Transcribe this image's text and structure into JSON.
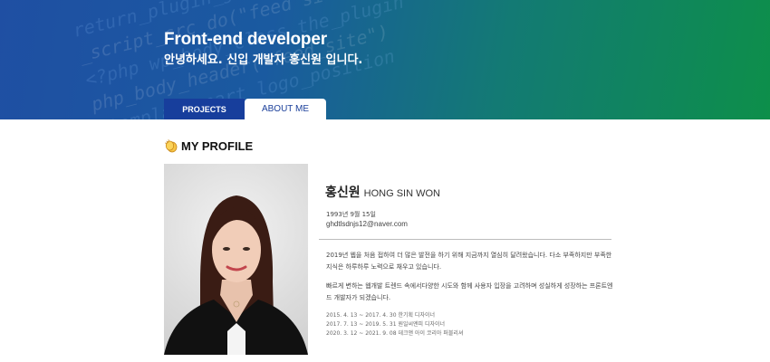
{
  "hero": {
    "title": "Front-end developer",
    "subtitle": "안녕하세요. 신입 개발자 홍신원 입니다.",
    "code_lines": [
      "return_plugin_get_Tags_ti",
      "_script_src_do(\"feed site\")",
      "<?php wp_body_class_the_plugin",
      "php_body_header(\"feed_site\")",
      "_template_part_logo_position"
    ]
  },
  "tabs": [
    {
      "label": "PROJECTS",
      "active": false
    },
    {
      "label": "ABOUT ME",
      "active": true
    }
  ],
  "profile": {
    "section_icon": "clapping-hands-icon",
    "section_title": "MY PROFILE",
    "name_ko": "홍신원",
    "name_en": "HONG SIN WON",
    "birth": "1993년 9월 15일",
    "email": "ghdtlsdnjs12@naver.com",
    "paragraph1": "2019년 웹을 처음 접하여 더 많은 발전을 하기 위해 지금까지 열심히 달려왔습니다. 다소 부족하지만 부족한 지식은 하루하루 노력으로 채우고 있습니다.",
    "paragraph2": "빠르게 변하는 웹개발 트렌드 속에서다양한 시도와 함께 사용자 입장을 고려하며 성실하게 성장하는 프론트엔드 개발자가 되겠습니다.",
    "history": [
      "2015. 4. 13 ~ 2017. 4. 30 한기획 디자이너",
      "2017. 7. 13 ~ 2019. 5. 31 원일씨엔피 디자이너",
      "2020. 3. 12 ~ 2021. 9. 08 데크앤 아이 코리아 퍼블리셔"
    ]
  },
  "colors": {
    "hero_start": "#1f4fa3",
    "hero_end": "#0d8f4a",
    "tab_active_text": "#1b3f9a",
    "tab_inactive_bg": "#173e9c"
  }
}
